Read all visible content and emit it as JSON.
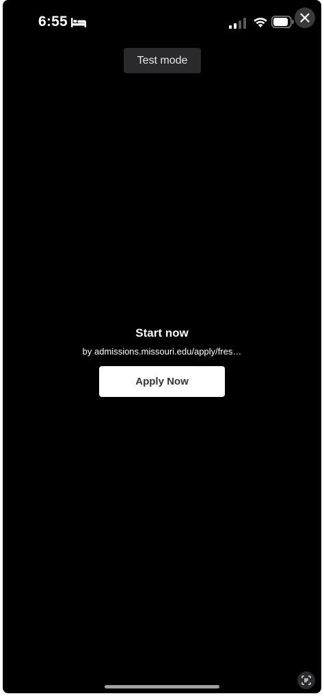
{
  "status_bar": {
    "time": "6:55",
    "sleep_icon": "bed-icon",
    "signal_icon": "cellular-signal-icon",
    "wifi_icon": "wifi-icon",
    "battery_icon": "battery-icon"
  },
  "close_icon": "close-icon",
  "badge": {
    "label": "Test mode"
  },
  "content": {
    "title": "Start now",
    "subtitle": "by admissions.missouri.edu/apply/fres…",
    "button_label": "Apply Now"
  },
  "scan_icon": "text-scan-icon",
  "colors": {
    "background": "#000000",
    "button_bg": "#ffffff",
    "button_text": "#333333",
    "badge_bg": "#2a2a2c"
  }
}
